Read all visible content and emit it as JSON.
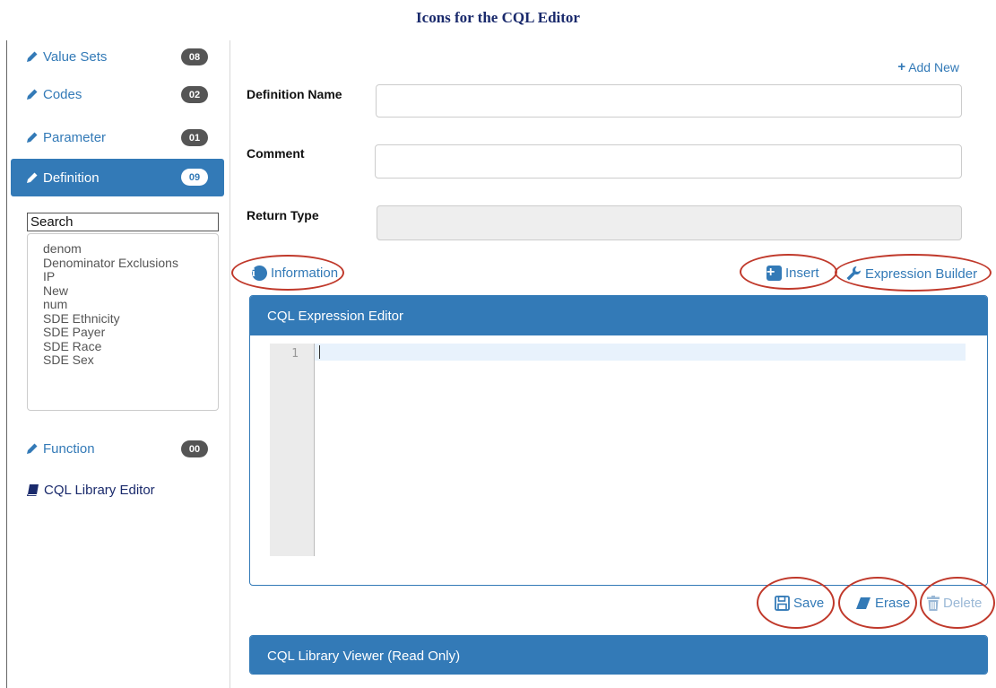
{
  "page_title": "Icons for the CQL Editor",
  "sidebar": {
    "items": [
      {
        "label": "Value Sets",
        "badge": "08"
      },
      {
        "label": "Codes",
        "badge": "02"
      },
      {
        "label": "Parameter",
        "badge": "01"
      },
      {
        "label": "Definition",
        "badge": "09",
        "active": true
      },
      {
        "label": "Function",
        "badge": "00"
      }
    ],
    "search_value": "Search",
    "definitions": [
      "denom",
      "Denominator Exclusions",
      "IP",
      "New",
      "num",
      "SDE Ethnicity",
      "SDE Payer",
      "SDE Race",
      "SDE Sex"
    ],
    "library_link": "CQL Library Editor"
  },
  "form": {
    "add_new": "Add New",
    "definition_name_label": "Definition Name",
    "definition_name_value": "",
    "comment_label": "Comment",
    "comment_value": "",
    "return_type_label": "Return Type",
    "return_type_value": ""
  },
  "toolbar": {
    "information": "Information",
    "insert": "Insert",
    "expression_builder": "Expression Builder"
  },
  "editor": {
    "title": "CQL Expression Editor",
    "line_numbers": [
      "1"
    ]
  },
  "actions": {
    "save": "Save",
    "erase": "Erase",
    "delete": "Delete"
  },
  "viewer": {
    "title": "CQL Library Viewer (Read Only)"
  },
  "colors": {
    "accent": "#337ab7",
    "highlight_ring": "#c0392b",
    "badge": "#555555"
  }
}
